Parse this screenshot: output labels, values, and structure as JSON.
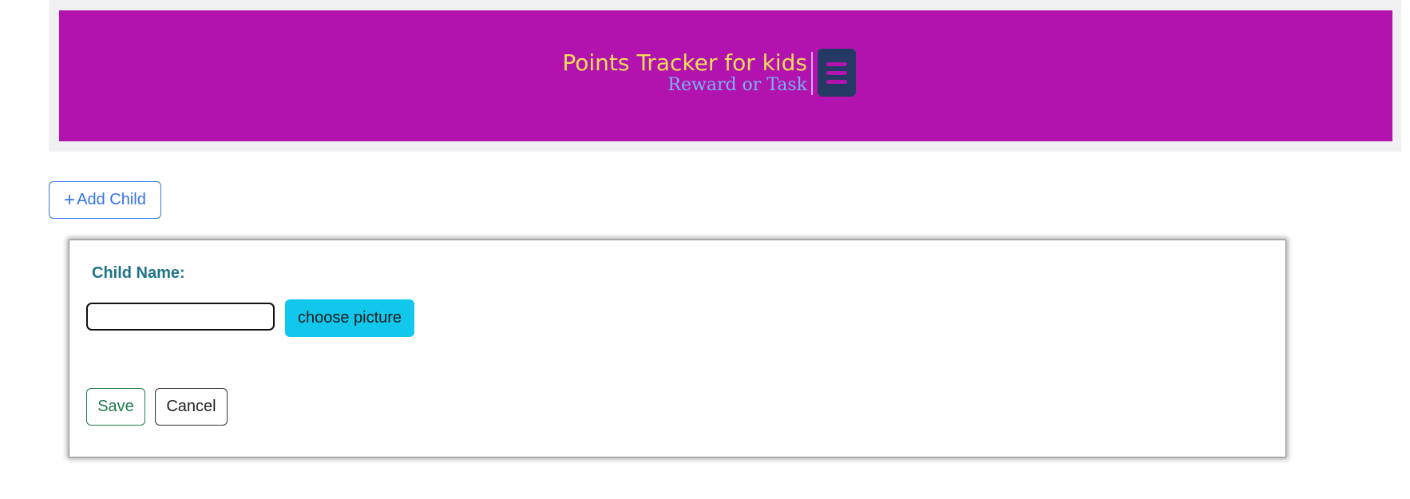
{
  "header": {
    "title": "Points Tracker for kids",
    "subtitle": "Reward or Task",
    "menu_icon": "hamburger-menu-icon",
    "colors": {
      "banner": "#b213ae",
      "title": "#f2dd56",
      "subtitle": "#79b3ee",
      "menu_button": "#243a64"
    }
  },
  "actions": {
    "add_child_icon": "+",
    "add_child_label": "Add Child"
  },
  "form": {
    "child_name_label": "Child Name:",
    "child_name_value": "",
    "child_name_placeholder": "",
    "choose_picture_label": "choose picture",
    "save_label": "Save",
    "cancel_label": "Cancel"
  }
}
